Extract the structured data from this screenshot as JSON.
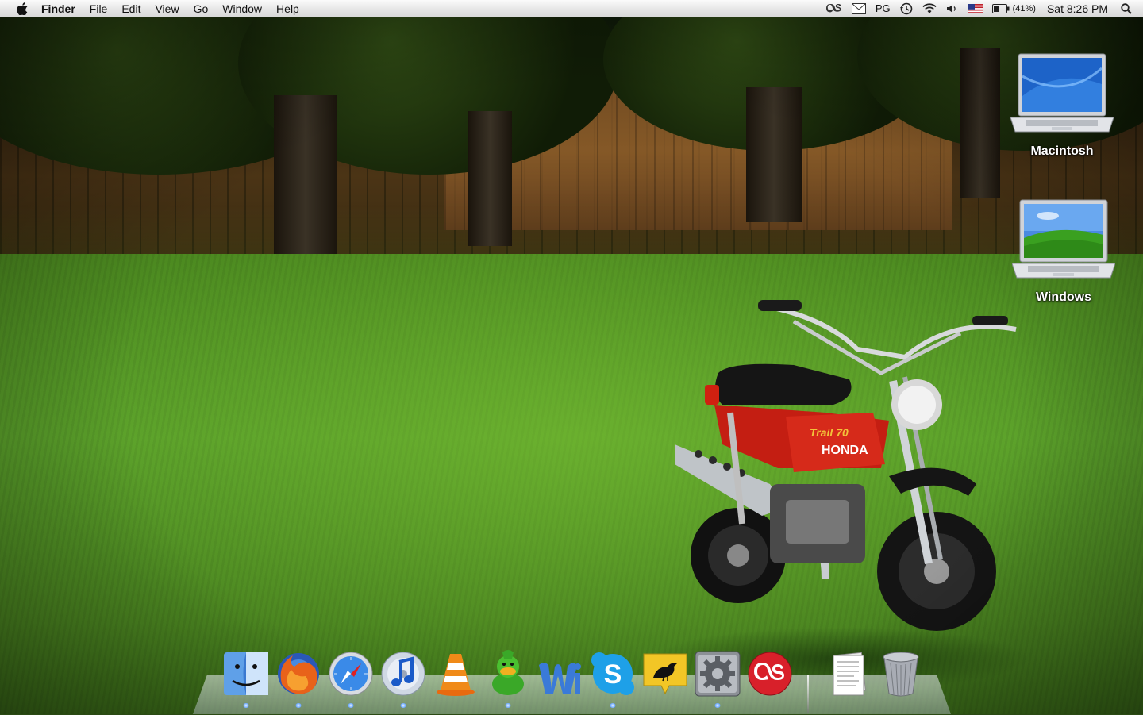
{
  "menubar": {
    "app_name": "Finder",
    "menus": [
      "File",
      "Edit",
      "View",
      "Go",
      "Window",
      "Help"
    ],
    "status": {
      "input_label": "PG",
      "battery_percent": "(41%)",
      "clock": "Sat 8:26 PM"
    }
  },
  "desktop": {
    "icons": [
      {
        "label": "Macintosh"
      },
      {
        "label": "Windows"
      }
    ]
  },
  "dock": {
    "apps": [
      {
        "icon": "finder-icon"
      },
      {
        "icon": "firefox-icon"
      },
      {
        "icon": "safari-icon"
      },
      {
        "icon": "itunes-icon"
      },
      {
        "icon": "vlc-icon"
      },
      {
        "icon": "adium-icon"
      },
      {
        "icon": "word-icon"
      },
      {
        "icon": "skype-icon"
      },
      {
        "icon": "tweetie-icon"
      },
      {
        "icon": "system-preferences-icon"
      },
      {
        "icon": "lastfm-icon"
      }
    ],
    "others": [
      {
        "icon": "documents-stack-icon"
      },
      {
        "icon": "trash-icon"
      }
    ]
  },
  "colors": {
    "menubar_bg": "#e6e6e6",
    "dock_indicator": "#6aa7ff",
    "wallpaper_grass": "#5aa02a"
  }
}
